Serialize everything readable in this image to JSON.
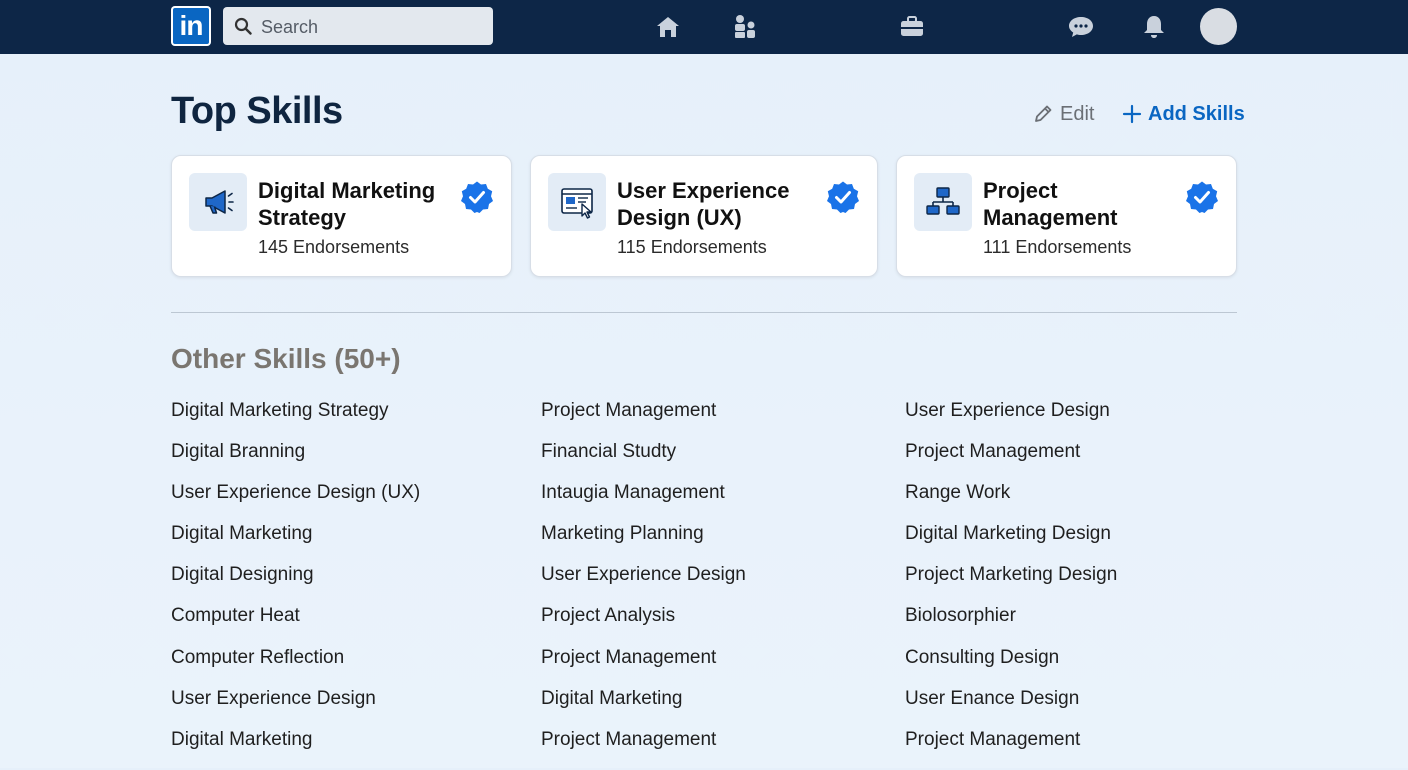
{
  "nav": {
    "logo_text": "in",
    "search_placeholder": "Search",
    "icons": [
      "home-icon",
      "my-network-icon",
      "jobs-icon",
      "messaging-icon",
      "notifications-icon",
      "avatar"
    ]
  },
  "header": {
    "title": "Top Skills",
    "edit_label": "Edit",
    "add_label": "Add Skills"
  },
  "top_skills": [
    {
      "name": "Digital Marketing Strategy",
      "endorsements": "145 Endorsements",
      "icon": "megaphone-icon"
    },
    {
      "name": "User Experience Design (UX)",
      "endorsements": "115 Endorsements",
      "icon": "ux-window-icon"
    },
    {
      "name": "Project Management",
      "endorsements": "111 Endorsements",
      "icon": "org-chart-icon"
    }
  ],
  "other_skills": {
    "title": "Other Skills (50+)",
    "columns": [
      [
        "Digital Marketing Strategy",
        "Digital Branning",
        "User Experience Design (UX)",
        "Digital Marketing",
        "Digital Designing",
        "Computer Heat",
        "Computer Reflection",
        "User Experience Design",
        "Digital Marketing"
      ],
      [
        "Project Management",
        "Financial Studty",
        "Intaugia Management",
        "Marketing Planning",
        "User Experience Design",
        "Project Analysis",
        "Project Management",
        "Digital Marketing",
        "Project Management"
      ],
      [
        "User Experience Design",
        "Project Management",
        "Range Work",
        "Digital Marketing Design",
        "Project Marketing Design",
        "Biolosorphier",
        "Consulting Design",
        "User Enance Design",
        "Project Management"
      ]
    ]
  },
  "colors": {
    "nav_bg": "#0d2647",
    "accent": "#0a66c2",
    "verified_badge": "#1a73e8",
    "title": "#0f2540",
    "section_title": "#7a7670"
  }
}
